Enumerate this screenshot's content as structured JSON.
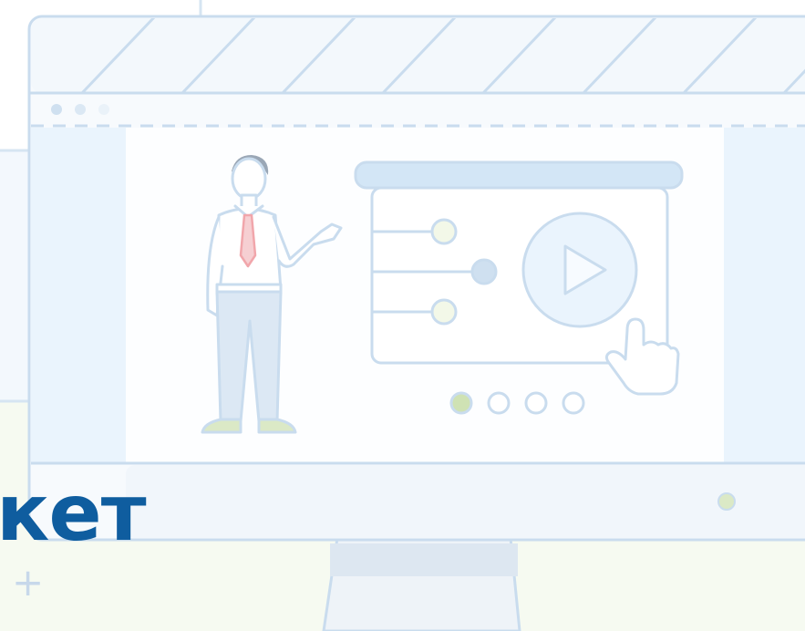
{
  "headline": {
    "partial_text": "кет"
  },
  "decorations": {
    "plus_glyph": "+"
  },
  "window": {
    "controls": [
      "dot",
      "dot",
      "dot"
    ]
  },
  "video_player": {
    "icon": "play-icon",
    "options": [
      {
        "state": "neutral"
      },
      {
        "state": "selected"
      },
      {
        "state": "neutral"
      }
    ],
    "carousel": {
      "dot_count": 4,
      "active_index": 0
    }
  },
  "colors": {
    "outline": "#c9dcee",
    "panel": "#eaf4fd",
    "accent_blue": "#0f5d9f",
    "carousel_active": "#cfe2b4",
    "tie": "#f1a6ab"
  }
}
